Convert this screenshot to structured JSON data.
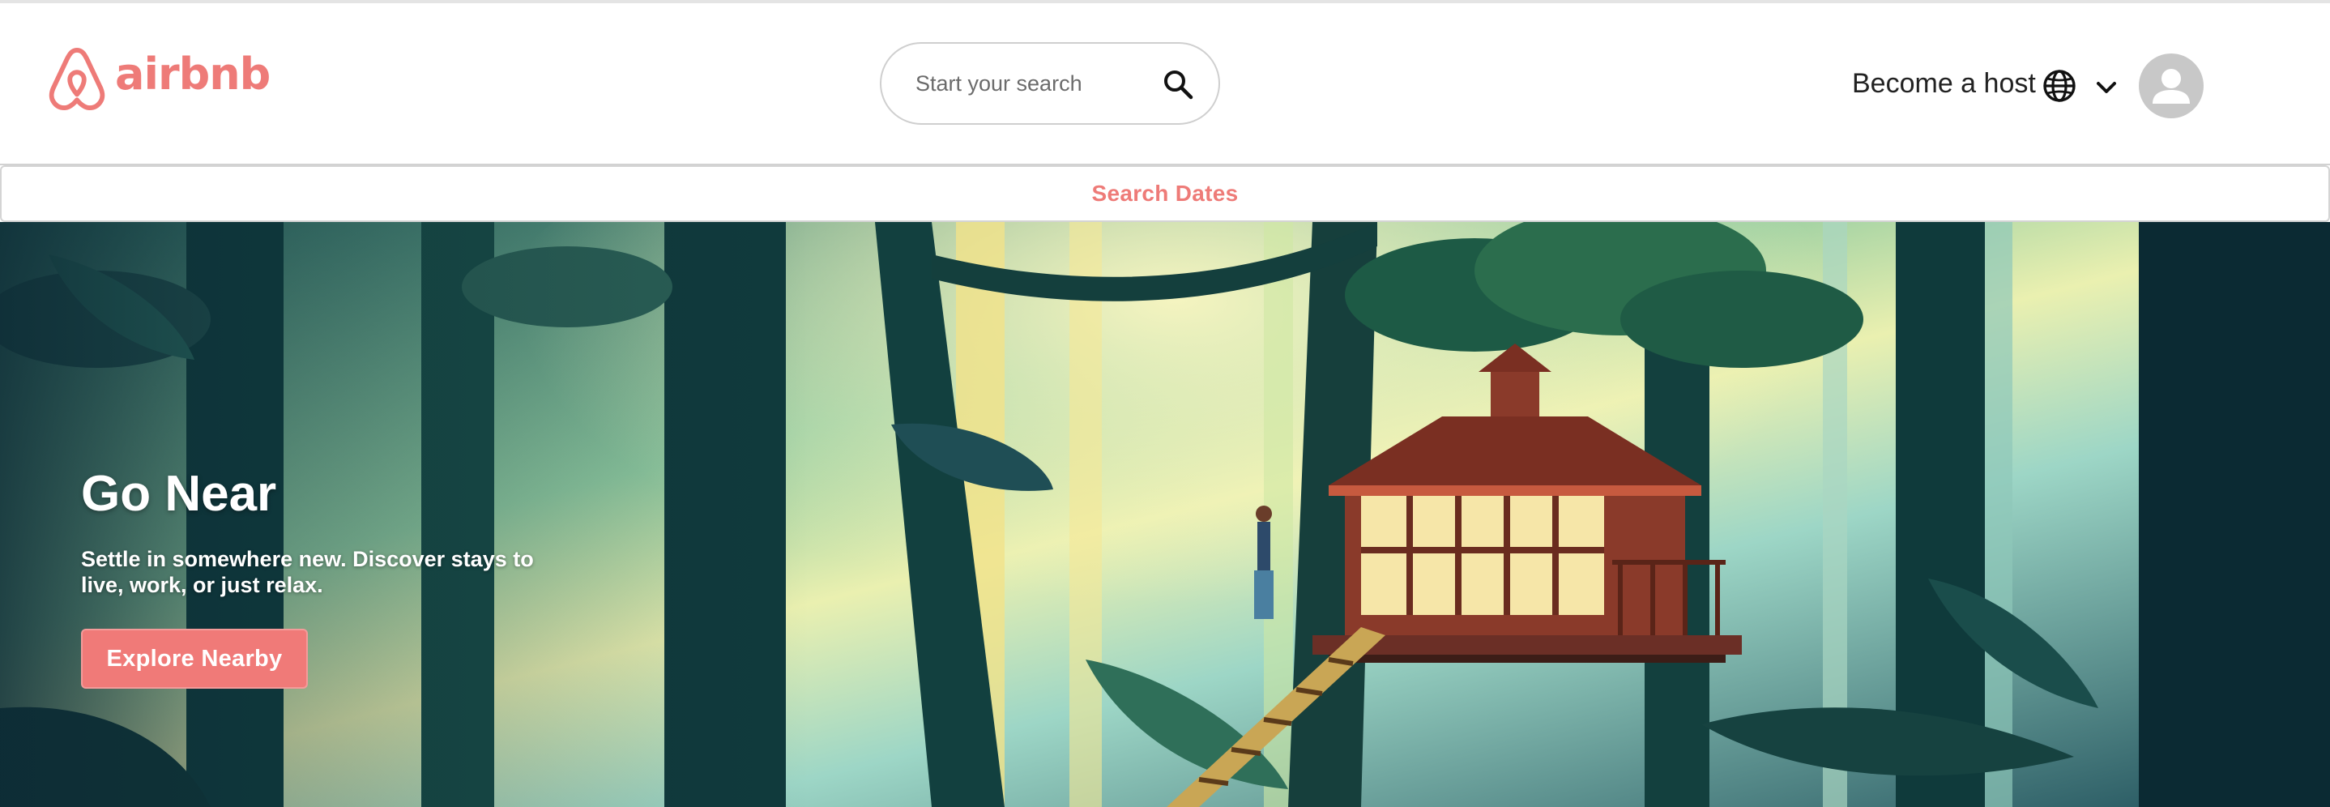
{
  "brand": {
    "name": "airbnb",
    "color": "#FF5A5F",
    "logo_color": "#EE7B78",
    "logo_icon": "airbnb-belo-icon"
  },
  "header": {
    "search": {
      "placeholder": "Start your search",
      "value": "",
      "icon": "search-icon"
    },
    "host_link": "Become a host",
    "language_icon": "globe-icon",
    "menu_icon": "chevron-down-icon",
    "avatar_icon": "user-avatar-icon"
  },
  "dates_bar": {
    "label": "Search Dates",
    "color": "#EE7B78"
  },
  "hero": {
    "title": "Go Near",
    "subtitle": "Settle in somewhere new. Discover stays to live, work, or just relax.",
    "button_label": "Explore Nearby",
    "button_color": "#F07A78",
    "image_subject": "treehouse-forest-illustration"
  }
}
